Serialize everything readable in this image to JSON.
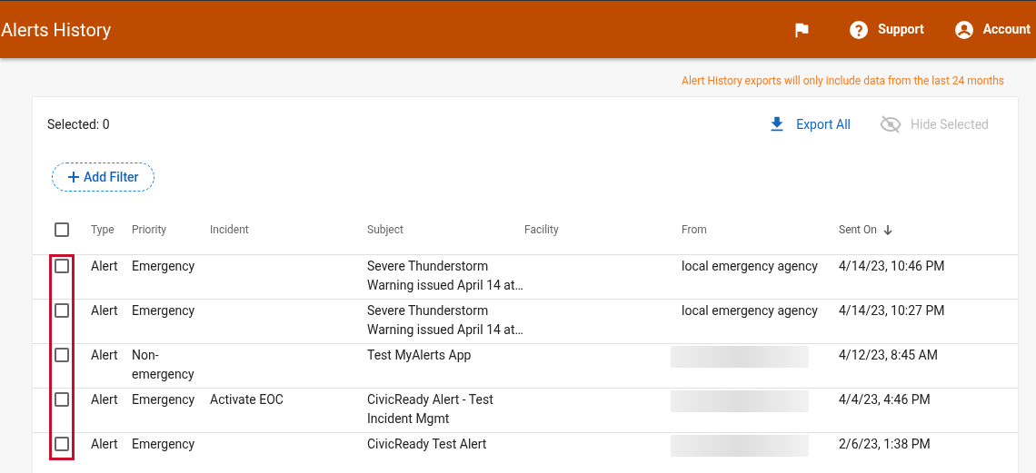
{
  "header": {
    "title": "Alerts History",
    "actions": [
      {
        "kind": "flag"
      },
      {
        "kind": "help",
        "label": "Support"
      },
      {
        "kind": "account",
        "label": "Account"
      }
    ]
  },
  "notice": "Alert History exports will only include data from the last 24 months",
  "toolbar": {
    "selected_count": "Selected: 0",
    "buttons": [
      {
        "kind": "download",
        "label": "Export All",
        "disabled": false
      },
      {
        "kind": "hide",
        "label": "Hide Selected",
        "disabled": true
      }
    ]
  },
  "add_filter": "Add Filter",
  "table": {
    "select_all_checked": false,
    "columns": [
      {
        "label": "Type",
        "sorted": false
      },
      {
        "label": "Priority",
        "sorted": false
      },
      {
        "label": "Incident",
        "sorted": false
      },
      {
        "label": "Subject",
        "sorted": false
      },
      {
        "label": "Facility",
        "sorted": false
      },
      {
        "label": "From",
        "sorted": false
      },
      {
        "label": "Sent On",
        "sorted": true
      }
    ],
    "rows": [
      {
        "checked": false,
        "type": "Alert",
        "priority": "Emergency",
        "subject": "Severe Thunderstorm\nWarning issued April 14 at…",
        "from": "local emergency agency",
        "from_redacted": false,
        "sent_on": "4/14/23, 10:46 PM"
      },
      {
        "checked": false,
        "type": "Alert",
        "priority": "Emergency",
        "subject": "Severe Thunderstorm\nWarning issued April 14 at…",
        "from": "local emergency agency",
        "from_redacted": false,
        "sent_on": "4/14/23, 10:27 PM"
      },
      {
        "checked": false,
        "type": "Alert",
        "priority": "Non-emergency",
        "subject": "Test MyAlerts App",
        "from_redacted": true,
        "sent_on": "4/12/23, 8:45 AM"
      },
      {
        "checked": false,
        "type": "Alert",
        "priority": "Emergency",
        "incident": "Activate EOC",
        "subject": "CivicReady Alert - Test\nIncident Mgmt",
        "from_redacted": true,
        "sent_on": "4/4/23, 4:46 PM"
      },
      {
        "checked": false,
        "type": "Alert",
        "priority": "Emergency",
        "subject": "CivicReady Test Alert",
        "from_redacted": true,
        "sent_on": "2/6/23, 1:38 PM"
      }
    ]
  }
}
